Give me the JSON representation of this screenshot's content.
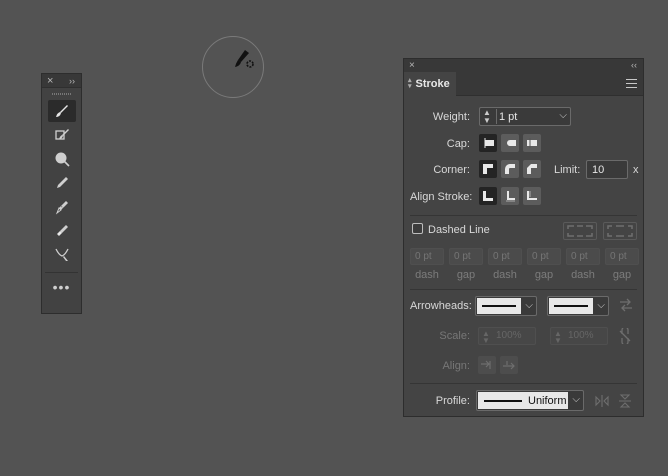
{
  "tools_panel": {
    "close": "×",
    "collapse": "››",
    "more": "•••",
    "tools": [
      {
        "name": "paintbrush-icon",
        "active": true
      },
      {
        "name": "shaper-icon",
        "active": false
      },
      {
        "name": "blob-brush-icon",
        "active": false
      },
      {
        "name": "pencil-icon",
        "active": false
      },
      {
        "name": "smooth-tool-icon",
        "active": false
      },
      {
        "name": "path-eraser-icon",
        "active": false
      },
      {
        "name": "join-tool-icon",
        "active": false
      }
    ]
  },
  "stroke_panel": {
    "close": "×",
    "collapse": "‹‹",
    "tab_label": "Stroke",
    "weight": {
      "label": "Weight:",
      "value": "1 pt"
    },
    "cap": {
      "label": "Cap:"
    },
    "corner": {
      "label": "Corner:",
      "limit_label": "Limit:",
      "limit_value": "10",
      "limit_unit": "x"
    },
    "align": {
      "label": "Align Stroke:"
    },
    "dashed": {
      "label": "Dashed Line",
      "checked": false,
      "fields": [
        {
          "placeholder": "0 pt",
          "label": "dash"
        },
        {
          "placeholder": "0 pt",
          "label": "gap"
        },
        {
          "placeholder": "0 pt",
          "label": "dash"
        },
        {
          "placeholder": "0 pt",
          "label": "gap"
        },
        {
          "placeholder": "0 pt",
          "label": "dash"
        },
        {
          "placeholder": "0 pt",
          "label": "gap"
        }
      ]
    },
    "arrowheads": {
      "label": "Arrowheads:"
    },
    "scale": {
      "label": "Scale:",
      "start": "100%",
      "end": "100%"
    },
    "align_arrow": {
      "label": "Align:"
    },
    "profile": {
      "label": "Profile:",
      "value": "Uniform"
    }
  },
  "colors": {
    "canvas": "#535353",
    "panel": "#444444",
    "selected_button": "#242424"
  }
}
